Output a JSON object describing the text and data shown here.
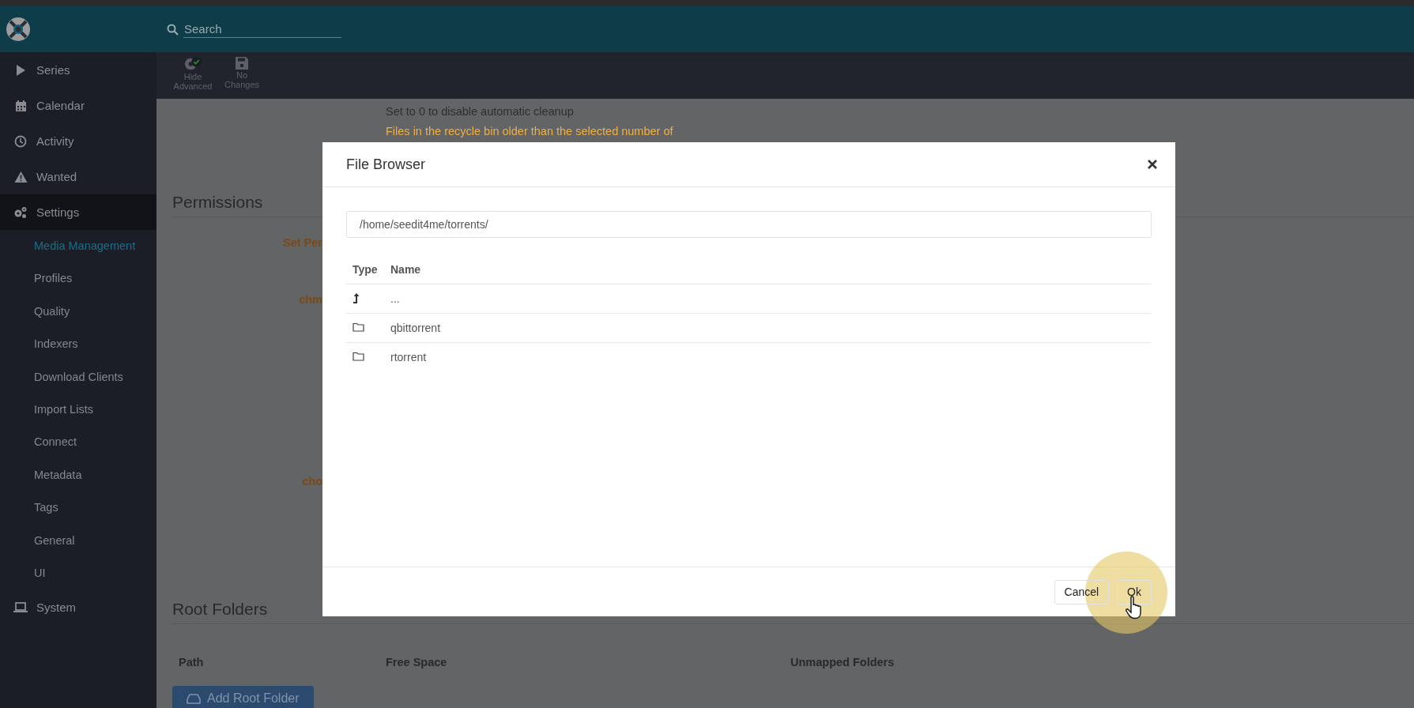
{
  "header": {
    "search": {
      "placeholder": "Search"
    }
  },
  "sidebar": {
    "items": [
      {
        "label": "Series",
        "selected": false
      },
      {
        "label": "Calendar",
        "selected": false
      },
      {
        "label": "Activity",
        "selected": false
      },
      {
        "label": "Wanted",
        "selected": false
      },
      {
        "label": "Settings",
        "selected": true,
        "children": [
          {
            "label": "Media Management",
            "selected": true
          },
          {
            "label": "Profiles",
            "selected": false
          },
          {
            "label": "Quality",
            "selected": false
          },
          {
            "label": "Indexers",
            "selected": false
          },
          {
            "label": "Download Clients",
            "selected": false
          },
          {
            "label": "Import Lists",
            "selected": false
          },
          {
            "label": "Connect",
            "selected": false
          },
          {
            "label": "Metadata",
            "selected": false
          },
          {
            "label": "Tags",
            "selected": false
          },
          {
            "label": "General",
            "selected": false
          },
          {
            "label": "UI",
            "selected": false
          }
        ]
      },
      {
        "label": "System",
        "selected": false
      }
    ]
  },
  "toolbar": {
    "buttons": [
      {
        "kind": "advanced",
        "label": "Hide Advanced"
      },
      {
        "kind": "save",
        "label": "No Changes"
      }
    ]
  },
  "settings": {
    "notes": [
      {
        "kind": "help",
        "text": "Set to 0 to disable automatic cleanup"
      },
      {
        "kind": "warning",
        "text": "Files in the recycle bin older than the selected number of"
      }
    ],
    "permissions": {
      "title": "Permissions",
      "labels": [
        "Set Per",
        "chm",
        "cho"
      ]
    },
    "root_folders": {
      "title": "Root Folders",
      "columns": [
        "Path",
        "Free Space",
        "Unmapped Folders"
      ],
      "add_button": "Add Root Folder"
    }
  },
  "modal": {
    "title": "File Browser",
    "path": "/home/seedit4me/torrents/",
    "columns": [
      "Type",
      "Name"
    ],
    "rows": [
      {
        "kind": "parent",
        "name": "..."
      },
      {
        "kind": "folder",
        "name": "qbittorrent"
      },
      {
        "kind": "folder",
        "name": "rtorrent"
      }
    ],
    "buttons": [
      {
        "label": "Cancel"
      },
      {
        "label": "Ok"
      }
    ]
  }
}
